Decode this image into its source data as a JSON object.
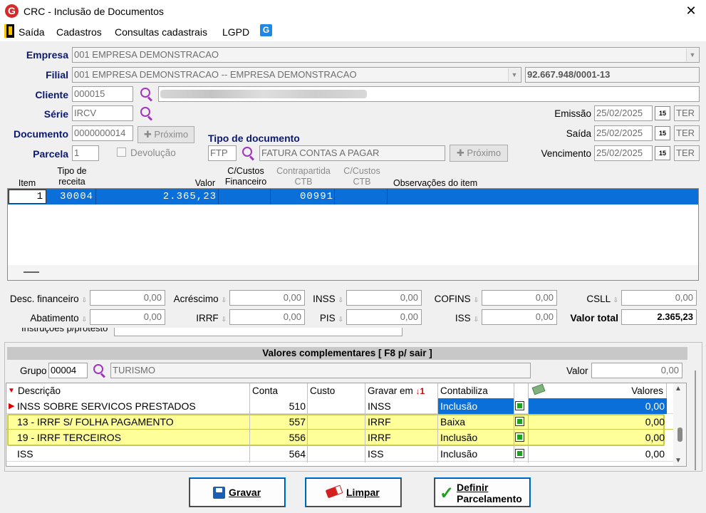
{
  "window": {
    "title": "CRC - Inclusão de Documentos",
    "close": "✕",
    "logo": "G"
  },
  "menu": {
    "items": [
      "Saída",
      "Cadastros",
      "Consultas cadastrais",
      "LGPD"
    ],
    "icon_badge": "G"
  },
  "form": {
    "empresa_label": "Empresa",
    "empresa_value": "001 EMPRESA DEMONSTRACAO",
    "filial_label": "Filial",
    "filial_value": "001 EMPRESA DEMONSTRACAO -- EMPRESA DEMONSTRACAO",
    "cnpj": "92.667.948/0001-13",
    "cliente_label": "Cliente",
    "cliente_value": "000015",
    "serie_label": "Série",
    "serie_value": "IRCV",
    "documento_label": "Documento",
    "documento_value": "0000000014",
    "proximo_label": "Próximo",
    "parcela_label": "Parcela",
    "parcela_value": "1",
    "devolucao_label": "Devolução",
    "tipo_doc_label": "Tipo de documento",
    "tipo_doc_code": "FTP",
    "tipo_doc_desc": "FATURA CONTAS A PAGAR",
    "emissao_label": "Emissão",
    "emissao_value": "25/02/2025",
    "emissao_day": "TER",
    "saida_label": "Saída",
    "saida_value": "25/02/2025",
    "saida_day": "TER",
    "vencimento_label": "Vencimento",
    "vencimento_value": "25/02/2025",
    "vencimento_day": "TER",
    "calendar_badge": "15"
  },
  "items_grid": {
    "headers": {
      "item": "Item",
      "tipo1": "Tipo de",
      "tipo2": "receita",
      "valor": "Valor",
      "cc1": "C/Custos",
      "cc2": "Financeiro",
      "cp1": "Contrapartida",
      "cp2": "CTB",
      "cc3": "C/Custos",
      "cc4": "CTB",
      "obs": "Observações do item"
    },
    "row": {
      "item": "1",
      "tipo": "30004",
      "valor": "2.365,23",
      "contrapartida": "00991"
    }
  },
  "totals": {
    "desc_fin_label": "Desc. financeiro",
    "desc_fin": "0,00",
    "acrescimo_label": "Acréscimo",
    "acrescimo": "0,00",
    "inss_label": "INSS",
    "inss": "0,00",
    "cofins_label": "COFINS",
    "cofins": "0,00",
    "csll_label": "CSLL",
    "csll": "0,00",
    "abatimento_label": "Abatimento",
    "abatimento": "0,00",
    "irrf_label": "IRRF",
    "irrf": "0,00",
    "pis_label": "PIS",
    "pis": "0,00",
    "iss_label": "ISS",
    "iss": "0,00",
    "total_label": "Valor total",
    "total": "2.365,23",
    "hidden_label": "Instruções p/protesto"
  },
  "complementares": {
    "title": "Valores complementares [ F8 p/ sair ]",
    "grupo_label": "Grupo",
    "grupo_code": "00004",
    "grupo_desc": "TURISMO",
    "valor_label": "Valor",
    "valor_value": "0,00",
    "headers": {
      "descricao": "Descrição",
      "conta": "Conta",
      "custo": "Custo",
      "gravar": "Gravar em",
      "contabiliza": "Contabiliza",
      "valores": "Valores"
    },
    "rows": [
      {
        "descricao": "INSS SOBRE SERVICOS PRESTADOS",
        "conta": "510",
        "custo": "",
        "gravar": "INSS",
        "contabiliza": "Inclusão",
        "valor": "0,00"
      },
      {
        "descricao": "13 - IRRF S/ FOLHA PAGAMENTO",
        "conta": "557",
        "custo": "",
        "gravar": "IRRF",
        "contabiliza": "Baixa",
        "valor": "0,00"
      },
      {
        "descricao": "19 - IRRF TERCEIROS",
        "conta": "556",
        "custo": "",
        "gravar": "IRRF",
        "contabiliza": "Inclusão",
        "valor": "0,00"
      },
      {
        "descricao": "ISS",
        "conta": "564",
        "custo": "",
        "gravar": "ISS",
        "contabiliza": "Inclusão",
        "valor": "0,00"
      }
    ]
  },
  "buttons": {
    "gravar": "Gravar",
    "limpar": "Limpar",
    "definir1": "Definir",
    "definir2": "Parcelamento"
  },
  "colors": {
    "selection": "#0a6fd8",
    "highlight": "#ffff99",
    "highlight_border": "#c9c94a",
    "label": "#0b1a6e"
  }
}
